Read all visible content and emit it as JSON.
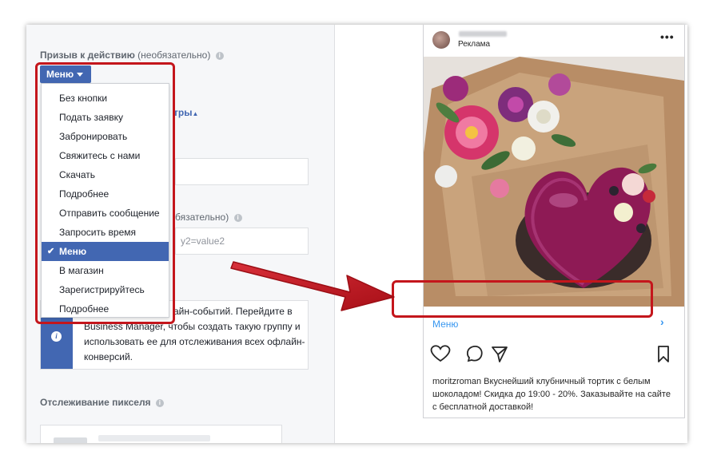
{
  "left_panel": {
    "cta_label": "Призыв к действию",
    "cta_optional": "(необязательно)",
    "menu_button_label": "Меню",
    "dropdown_items": [
      "Без кнопки",
      "Подать заявку",
      "Забронировать",
      "Свяжитесь с нами",
      "Скачать",
      "Подробнее",
      "Отправить сообщение",
      "Запросить время",
      "Меню",
      "В магазин",
      "Зарегистрируйтесь",
      "Подробнее"
    ],
    "dropdown_selected_check": "✔",
    "advanced_link": "тры",
    "optional_label": "бязательно)",
    "url_param_placeholder": "y2=value2",
    "notice_line1": "айн-событий. Перейдите в",
    "notice_rest": "Business Manager, чтобы создать такую группу и использовать ее для отслеживания всех офлайн-конверсий.",
    "pixel_tracking_label": "Отслеживание пикселя"
  },
  "preview": {
    "sponsored": "Реклама",
    "more_icon": "•••",
    "cta_text": "Меню",
    "cta_arrow": "›",
    "caption_user": "moritzroman",
    "caption_text": " Вкуснейший клубничный тортик с белым шоколадом! Скидка до 19:00 - 20%. Заказывайте на сайте с бесплатной доставкой!"
  },
  "colors": {
    "accent_blue": "#4267b2",
    "highlight_red": "#c4161c",
    "instagram_link": "#3897f0"
  }
}
